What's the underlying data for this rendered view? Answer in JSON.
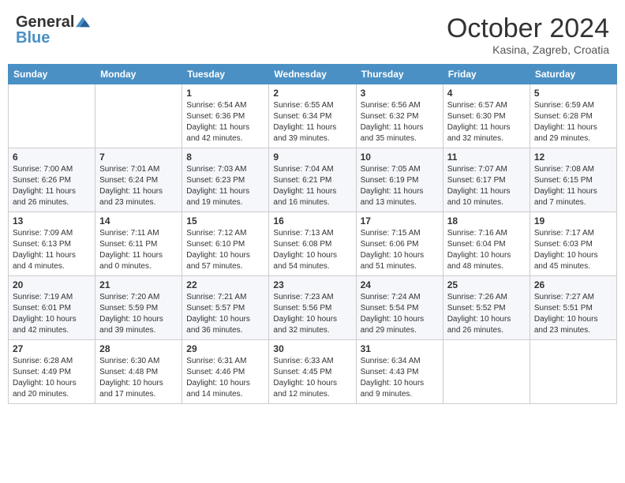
{
  "header": {
    "logo_general": "General",
    "logo_blue": "Blue",
    "month_title": "October 2024",
    "location": "Kasina, Zagreb, Croatia"
  },
  "days_of_week": [
    "Sunday",
    "Monday",
    "Tuesday",
    "Wednesday",
    "Thursday",
    "Friday",
    "Saturday"
  ],
  "weeks": [
    [
      {
        "day": "",
        "info": ""
      },
      {
        "day": "",
        "info": ""
      },
      {
        "day": "1",
        "info": "Sunrise: 6:54 AM\nSunset: 6:36 PM\nDaylight: 11 hours and 42 minutes."
      },
      {
        "day": "2",
        "info": "Sunrise: 6:55 AM\nSunset: 6:34 PM\nDaylight: 11 hours and 39 minutes."
      },
      {
        "day": "3",
        "info": "Sunrise: 6:56 AM\nSunset: 6:32 PM\nDaylight: 11 hours and 35 minutes."
      },
      {
        "day": "4",
        "info": "Sunrise: 6:57 AM\nSunset: 6:30 PM\nDaylight: 11 hours and 32 minutes."
      },
      {
        "day": "5",
        "info": "Sunrise: 6:59 AM\nSunset: 6:28 PM\nDaylight: 11 hours and 29 minutes."
      }
    ],
    [
      {
        "day": "6",
        "info": "Sunrise: 7:00 AM\nSunset: 6:26 PM\nDaylight: 11 hours and 26 minutes."
      },
      {
        "day": "7",
        "info": "Sunrise: 7:01 AM\nSunset: 6:24 PM\nDaylight: 11 hours and 23 minutes."
      },
      {
        "day": "8",
        "info": "Sunrise: 7:03 AM\nSunset: 6:23 PM\nDaylight: 11 hours and 19 minutes."
      },
      {
        "day": "9",
        "info": "Sunrise: 7:04 AM\nSunset: 6:21 PM\nDaylight: 11 hours and 16 minutes."
      },
      {
        "day": "10",
        "info": "Sunrise: 7:05 AM\nSunset: 6:19 PM\nDaylight: 11 hours and 13 minutes."
      },
      {
        "day": "11",
        "info": "Sunrise: 7:07 AM\nSunset: 6:17 PM\nDaylight: 11 hours and 10 minutes."
      },
      {
        "day": "12",
        "info": "Sunrise: 7:08 AM\nSunset: 6:15 PM\nDaylight: 11 hours and 7 minutes."
      }
    ],
    [
      {
        "day": "13",
        "info": "Sunrise: 7:09 AM\nSunset: 6:13 PM\nDaylight: 11 hours and 4 minutes."
      },
      {
        "day": "14",
        "info": "Sunrise: 7:11 AM\nSunset: 6:11 PM\nDaylight: 11 hours and 0 minutes."
      },
      {
        "day": "15",
        "info": "Sunrise: 7:12 AM\nSunset: 6:10 PM\nDaylight: 10 hours and 57 minutes."
      },
      {
        "day": "16",
        "info": "Sunrise: 7:13 AM\nSunset: 6:08 PM\nDaylight: 10 hours and 54 minutes."
      },
      {
        "day": "17",
        "info": "Sunrise: 7:15 AM\nSunset: 6:06 PM\nDaylight: 10 hours and 51 minutes."
      },
      {
        "day": "18",
        "info": "Sunrise: 7:16 AM\nSunset: 6:04 PM\nDaylight: 10 hours and 48 minutes."
      },
      {
        "day": "19",
        "info": "Sunrise: 7:17 AM\nSunset: 6:03 PM\nDaylight: 10 hours and 45 minutes."
      }
    ],
    [
      {
        "day": "20",
        "info": "Sunrise: 7:19 AM\nSunset: 6:01 PM\nDaylight: 10 hours and 42 minutes."
      },
      {
        "day": "21",
        "info": "Sunrise: 7:20 AM\nSunset: 5:59 PM\nDaylight: 10 hours and 39 minutes."
      },
      {
        "day": "22",
        "info": "Sunrise: 7:21 AM\nSunset: 5:57 PM\nDaylight: 10 hours and 36 minutes."
      },
      {
        "day": "23",
        "info": "Sunrise: 7:23 AM\nSunset: 5:56 PM\nDaylight: 10 hours and 32 minutes."
      },
      {
        "day": "24",
        "info": "Sunrise: 7:24 AM\nSunset: 5:54 PM\nDaylight: 10 hours and 29 minutes."
      },
      {
        "day": "25",
        "info": "Sunrise: 7:26 AM\nSunset: 5:52 PM\nDaylight: 10 hours and 26 minutes."
      },
      {
        "day": "26",
        "info": "Sunrise: 7:27 AM\nSunset: 5:51 PM\nDaylight: 10 hours and 23 minutes."
      }
    ],
    [
      {
        "day": "27",
        "info": "Sunrise: 6:28 AM\nSunset: 4:49 PM\nDaylight: 10 hours and 20 minutes."
      },
      {
        "day": "28",
        "info": "Sunrise: 6:30 AM\nSunset: 4:48 PM\nDaylight: 10 hours and 17 minutes."
      },
      {
        "day": "29",
        "info": "Sunrise: 6:31 AM\nSunset: 4:46 PM\nDaylight: 10 hours and 14 minutes."
      },
      {
        "day": "30",
        "info": "Sunrise: 6:33 AM\nSunset: 4:45 PM\nDaylight: 10 hours and 12 minutes."
      },
      {
        "day": "31",
        "info": "Sunrise: 6:34 AM\nSunset: 4:43 PM\nDaylight: 10 hours and 9 minutes."
      },
      {
        "day": "",
        "info": ""
      },
      {
        "day": "",
        "info": ""
      }
    ]
  ]
}
